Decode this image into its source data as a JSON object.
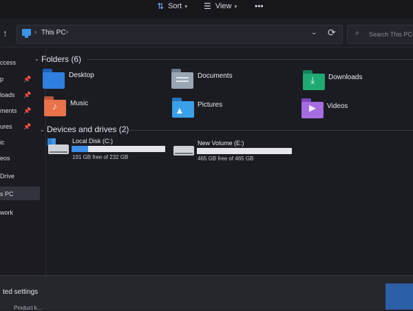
{
  "toolbar": {
    "sort_label": "Sort",
    "view_label": "View",
    "more_label": "•••"
  },
  "address": {
    "crumb": "This PC",
    "search_placeholder": "Search This PC"
  },
  "sidebar": {
    "items": [
      {
        "label": "ccess",
        "pinned": false
      },
      {
        "label": "p",
        "pinned": true
      },
      {
        "label": "loads",
        "pinned": true
      },
      {
        "label": "ments",
        "pinned": true
      },
      {
        "label": "ures",
        "pinned": true
      },
      {
        "label": "ic",
        "pinned": false
      },
      {
        "label": "eos",
        "pinned": false
      },
      {
        "label": "Drive",
        "pinned": false
      },
      {
        "label": "s PC",
        "pinned": false
      },
      {
        "label": "work",
        "pinned": false
      }
    ]
  },
  "folders": {
    "title": "Folders (6)",
    "items": [
      {
        "label": "Desktop",
        "color": "#2f7fe0",
        "icon": "desktop-folder-icon"
      },
      {
        "label": "Documents",
        "color": "#9aa6b4",
        "icon": "documents-folder-icon"
      },
      {
        "label": "Downloads",
        "color": "#1faa73",
        "icon": "downloads-folder-icon"
      },
      {
        "label": "Music",
        "color": "#e8734a",
        "icon": "music-folder-icon"
      },
      {
        "label": "Pictures",
        "color": "#3aa0e8",
        "icon": "pictures-folder-icon"
      },
      {
        "label": "Videos",
        "color": "#a56de0",
        "icon": "videos-folder-icon"
      }
    ]
  },
  "drives": {
    "title": "Devices and drives (2)",
    "items": [
      {
        "label": "Local Disk (C:)",
        "free_text": "191 GB free of 232 GB",
        "used_fraction": 0.18
      },
      {
        "label": "New Volume (E:)",
        "free_text": "465 GB free of 465 GB",
        "used_fraction": 0.0
      }
    ]
  },
  "bottom": {
    "label": "ted settings",
    "sub": "Product k..."
  },
  "colors": {
    "accent": "#3d8ee6"
  }
}
